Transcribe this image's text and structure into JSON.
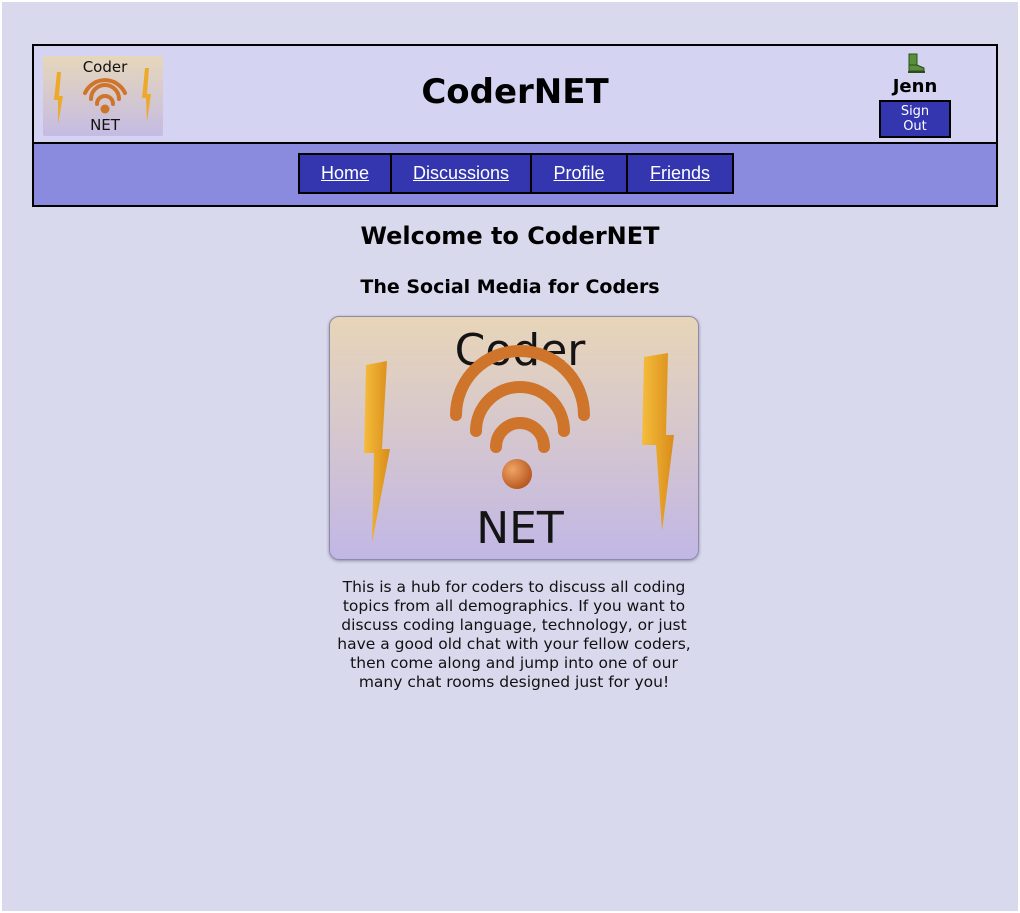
{
  "header": {
    "site_title": "CoderNET",
    "logo_text_top": "Coder",
    "logo_text_bottom": "NET"
  },
  "user": {
    "name": "Jenn",
    "sign_out_label": "Sign Out",
    "avatar_icon": "boot-icon"
  },
  "nav": {
    "items": [
      {
        "label": "Home"
      },
      {
        "label": "Discussions"
      },
      {
        "label": "Profile"
      },
      {
        "label": "Friends"
      }
    ]
  },
  "main": {
    "welcome": "Welcome to CoderNET",
    "tagline": "The Social Media for Coders",
    "intro": "This is a hub for coders to discuss all coding topics from all demographics. If you want to discuss coding language, technology, or just have a good old chat with your fellow coders, then come along and jump into one of our many chat rooms designed just for you!"
  },
  "colors": {
    "page_bg": "#d9d9ee",
    "header_bg": "#d4d4f2",
    "navbar_bg": "#8a8ade",
    "nav_button_bg": "#3436b0",
    "bolt": "#f0a92a",
    "wifi": "#d9772e"
  }
}
